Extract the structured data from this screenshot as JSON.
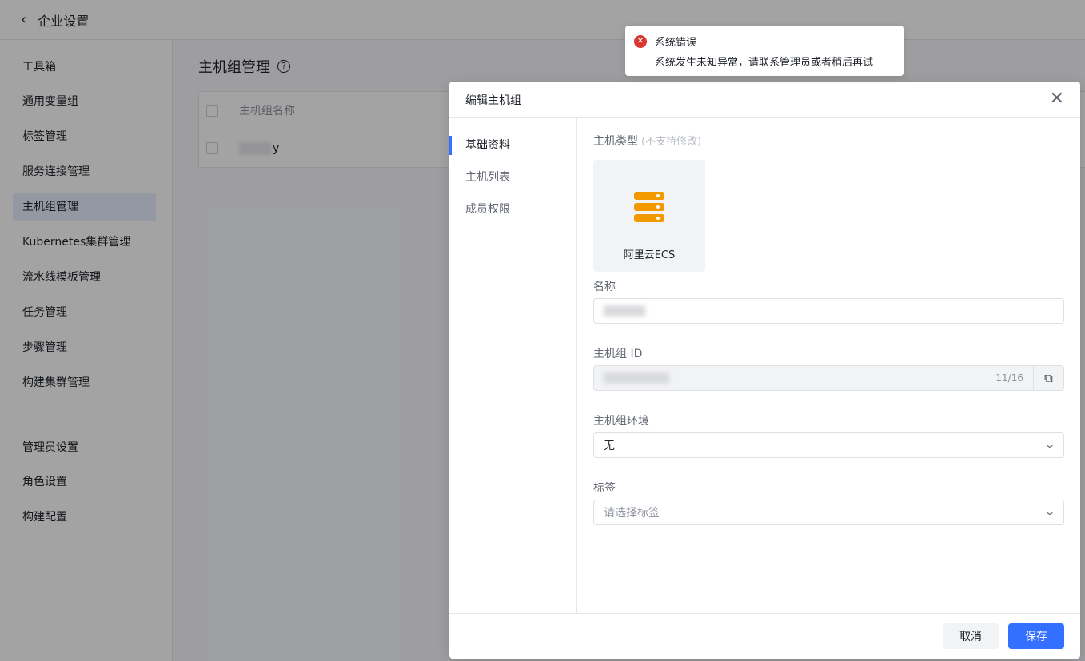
{
  "topbar": {
    "back_icon": "‹",
    "title": "企业设置"
  },
  "sidebar": {
    "group1": "工具箱",
    "items": [
      "通用变量组",
      "标签管理",
      "服务连接管理",
      "主机组管理",
      "Kubernetes集群管理",
      "流水线模板管理",
      "任务管理",
      "步骤管理",
      "构建集群管理"
    ],
    "group2": "管理员设置",
    "items2": [
      "角色设置",
      "构建配置"
    ],
    "active": "主机组管理"
  },
  "content": {
    "title": "主机组管理",
    "help_icon": "?",
    "table": {
      "header_name": "主机组名称",
      "row_name_suffix": "y"
    }
  },
  "modal": {
    "title": "编辑主机组",
    "close_icon": "✕",
    "nav": [
      "基础资料",
      "主机列表",
      "成员权限"
    ],
    "active_nav": "基础资料",
    "form": {
      "host_type_label": "主机类型",
      "host_type_hint": "(不支持修改)",
      "host_type_value": "阿里云ECS",
      "name_label": "名称",
      "id_label": "主机组 ID",
      "id_count": "11/16",
      "env_label": "主机组环境",
      "env_value": "无",
      "tag_label": "标签",
      "tag_placeholder": "请选择标签"
    },
    "cancel_label": "取消",
    "save_label": "保存"
  },
  "toast": {
    "title": "系统错误",
    "message": "系统发生未知异常，请联系管理员或者稍后再试"
  },
  "colors": {
    "primary": "#3370ff",
    "error": "#d83931",
    "ecs_icon": "#f29900"
  }
}
